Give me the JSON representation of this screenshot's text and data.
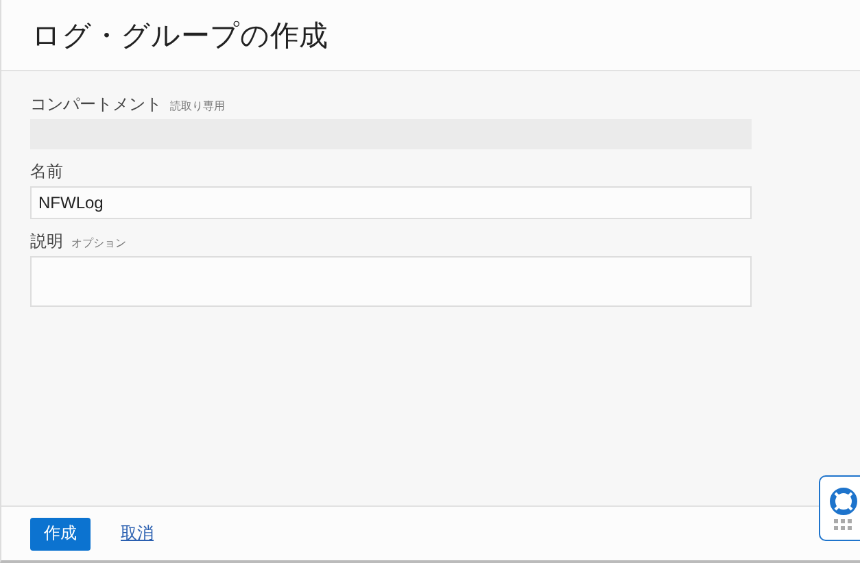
{
  "title": "ログ・グループの作成",
  "fields": [
    {
      "kind": "readonly",
      "label": "コンパートメント",
      "hint": "読取り専用"
    },
    {
      "kind": "text",
      "label": "名前",
      "value": "NFWLog"
    },
    {
      "kind": "textarea",
      "label": "説明",
      "hint": "オプション"
    }
  ],
  "buttons": {
    "primary": "作成",
    "cancel": "取消"
  }
}
